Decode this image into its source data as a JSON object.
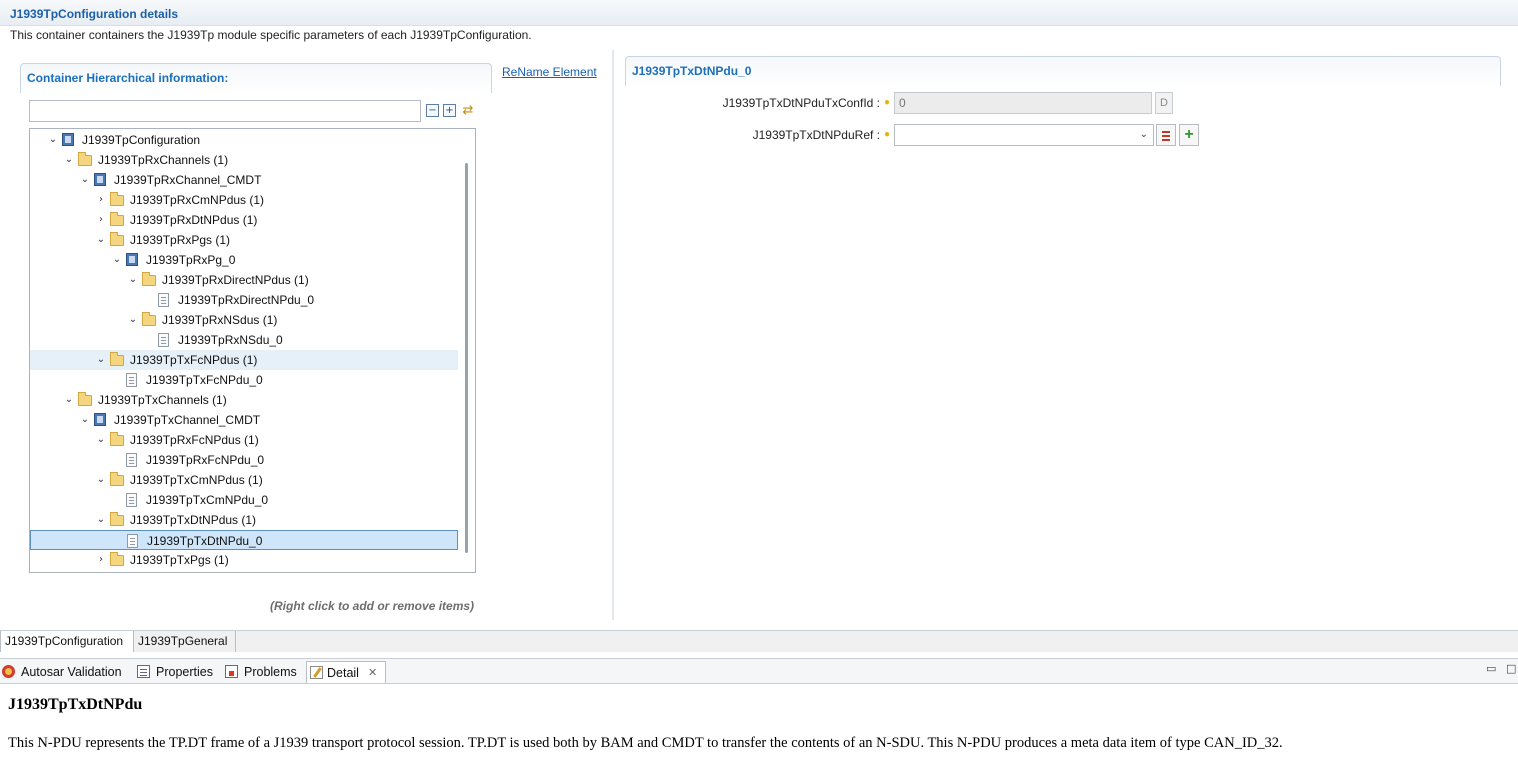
{
  "header": {
    "title": "J1939TpConfiguration details",
    "description": "This container containers the J1939Tp module specific parameters of each J1939TpConfiguration."
  },
  "hierarchy": {
    "section_title": "Container Hierarchical information:",
    "rename_link": "ReName Element",
    "filter_value": "",
    "collapse_icon": "collapse-all-icon",
    "expand_icon": "expand-all-icon",
    "sync_icon": "link-with-editor-icon",
    "hint": "(Right click to add or remove items)"
  },
  "tree": [
    {
      "label": "J1939TpConfiguration",
      "icon": "container",
      "expanded": "open"
    },
    {
      "label": "J1939TpRxChannels (1)",
      "icon": "folder",
      "expanded": "open"
    },
    {
      "label": "J1939TpRxChannel_CMDT",
      "icon": "container",
      "expanded": "open"
    },
    {
      "label": "J1939TpRxCmNPdus (1)",
      "icon": "folder",
      "expanded": "closed"
    },
    {
      "label": "J1939TpRxDtNPdus (1)",
      "icon": "folder",
      "expanded": "closed"
    },
    {
      "label": "J1939TpRxPgs (1)",
      "icon": "folder",
      "expanded": "open"
    },
    {
      "label": "J1939TpRxPg_0",
      "icon": "container",
      "expanded": "open"
    },
    {
      "label": "J1939TpRxDirectNPdus (1)",
      "icon": "folder",
      "expanded": "open"
    },
    {
      "label": "J1939TpRxDirectNPdu_0",
      "icon": "file",
      "expanded": "none"
    },
    {
      "label": "J1939TpRxNSdus (1)",
      "icon": "folder",
      "expanded": "open"
    },
    {
      "label": "J1939TpRxNSdu_0",
      "icon": "file",
      "expanded": "none"
    },
    {
      "label": "J1939TpTxFcNPdus (1)",
      "icon": "folder",
      "expanded": "open"
    },
    {
      "label": "J1939TpTxFcNPdu_0",
      "icon": "file",
      "expanded": "none"
    },
    {
      "label": "J1939TpTxChannels (1)",
      "icon": "folder",
      "expanded": "open"
    },
    {
      "label": "J1939TpTxChannel_CMDT",
      "icon": "container",
      "expanded": "open"
    },
    {
      "label": "J1939TpRxFcNPdus (1)",
      "icon": "folder",
      "expanded": "open"
    },
    {
      "label": "J1939TpRxFcNPdu_0",
      "icon": "file",
      "expanded": "none"
    },
    {
      "label": "J1939TpTxCmNPdus (1)",
      "icon": "folder",
      "expanded": "open"
    },
    {
      "label": "J1939TpTxCmNPdu_0",
      "icon": "file",
      "expanded": "none"
    },
    {
      "label": "J1939TpTxDtNPdus (1)",
      "icon": "folder",
      "expanded": "open"
    },
    {
      "label": "J1939TpTxDtNPdu_0",
      "icon": "file",
      "expanded": "none"
    },
    {
      "label": "J1939TpTxPgs (1)",
      "icon": "folder",
      "expanded": "closed"
    }
  ],
  "tree_state": {
    "selected": "J1939TpTxDtNPdu_0",
    "hovered": "J1939TpTxFcNPdus (1)"
  },
  "details": {
    "title": "J1939TpTxDtNPdu_0",
    "fields": [
      {
        "label": "J1939TpTxDtNPduTxConfId :",
        "value": "0",
        "button": "D"
      },
      {
        "label": "J1939TpTxDtNPduRef :",
        "value": ""
      }
    ]
  },
  "config_tabs": [
    {
      "label": "J1939TpConfiguration",
      "active": true
    },
    {
      "label": "J1939TpGeneral",
      "active": false
    }
  ],
  "view_tabs": [
    {
      "label": "Autosar Validation",
      "icon": "autosar-validation-icon"
    },
    {
      "label": "Properties",
      "icon": "properties-icon"
    },
    {
      "label": "Problems",
      "icon": "problems-icon"
    },
    {
      "label": "Detail",
      "icon": "detail-icon",
      "active": true
    }
  ],
  "detail_view": {
    "title": "J1939TpTxDtNPdu",
    "text": "This N-PDU represents the TP.DT frame of a J1939 transport protocol session. TP.DT is used both by BAM and CMDT to transfer the contents of an N-SDU. This N-PDU produces a meta data item of type CAN_ID_32."
  }
}
